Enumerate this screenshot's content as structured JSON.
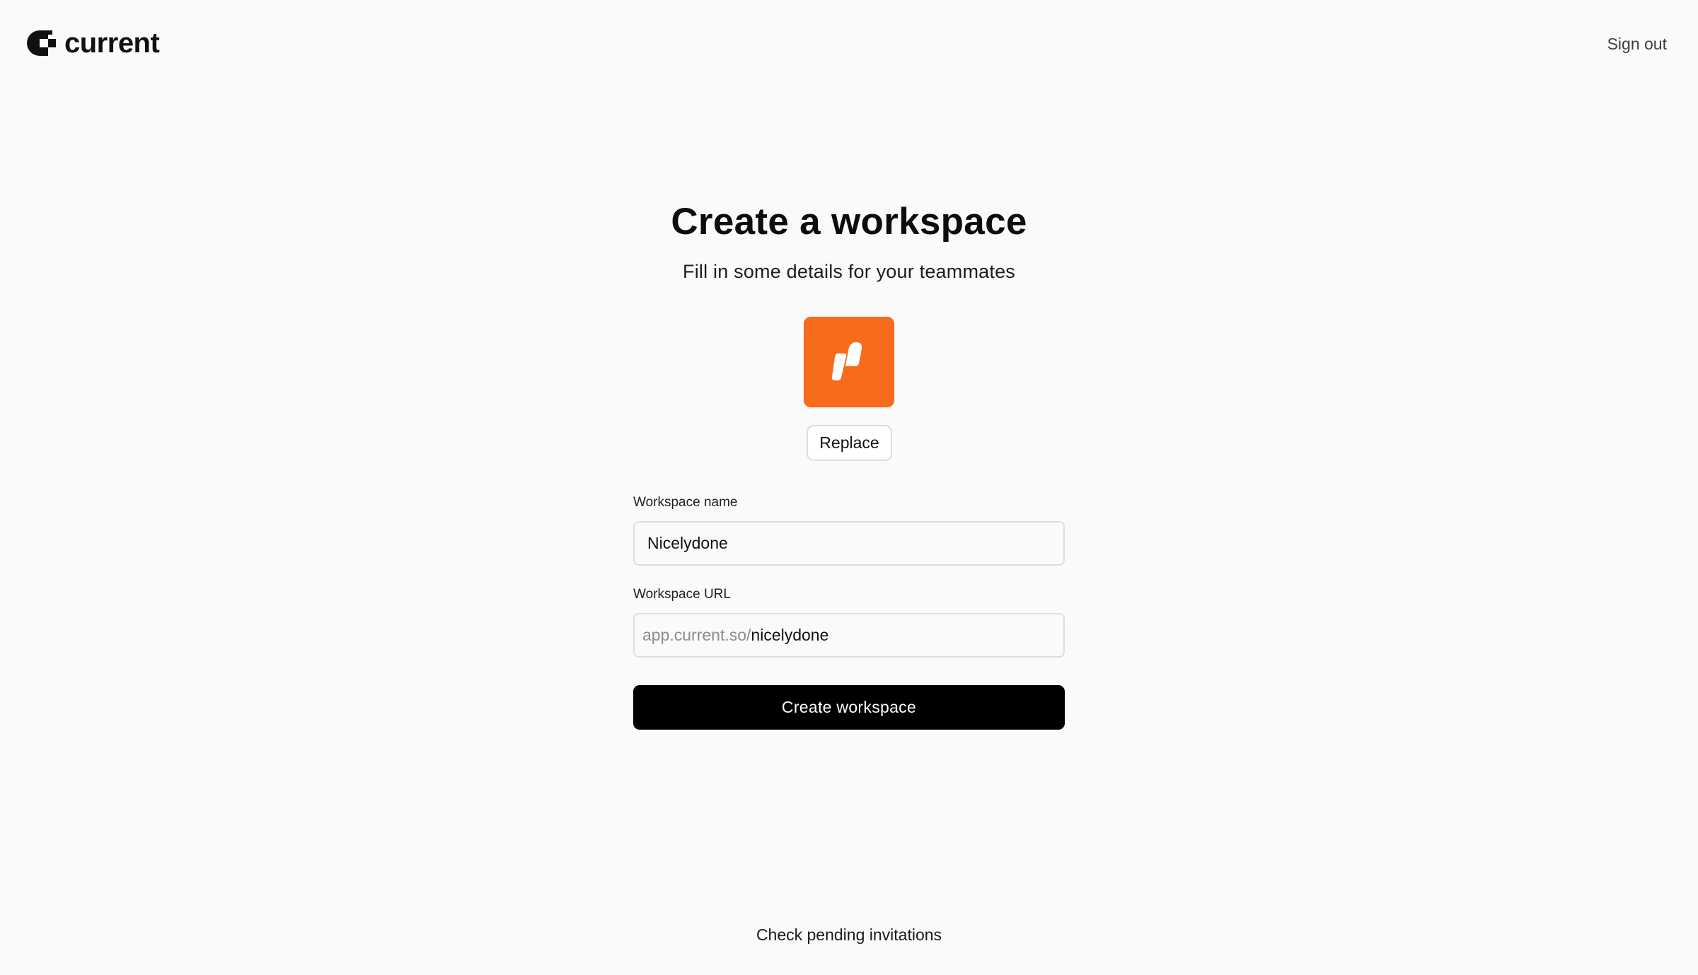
{
  "header": {
    "logo_text": "current",
    "logo_icon": "current-logo-icon",
    "sign_out_label": "Sign out"
  },
  "main": {
    "title": "Create a workspace",
    "subtitle": "Fill in some details for your teammates",
    "workspace_icon": {
      "icon": "workspace-logo-icon",
      "background_color": "#f76b1c"
    },
    "replace_label": "Replace",
    "fields": {
      "name": {
        "label": "Workspace name",
        "value": "Nicelydone"
      },
      "url": {
        "label": "Workspace URL",
        "prefix": "app.current.so/",
        "value": "nicelydone"
      }
    },
    "create_label": "Create workspace"
  },
  "footer": {
    "pending_invitations_label": "Check pending invitations"
  },
  "colors": {
    "background": "#fafafa",
    "accent": "#f76b1c",
    "primary_button": "#000000"
  }
}
